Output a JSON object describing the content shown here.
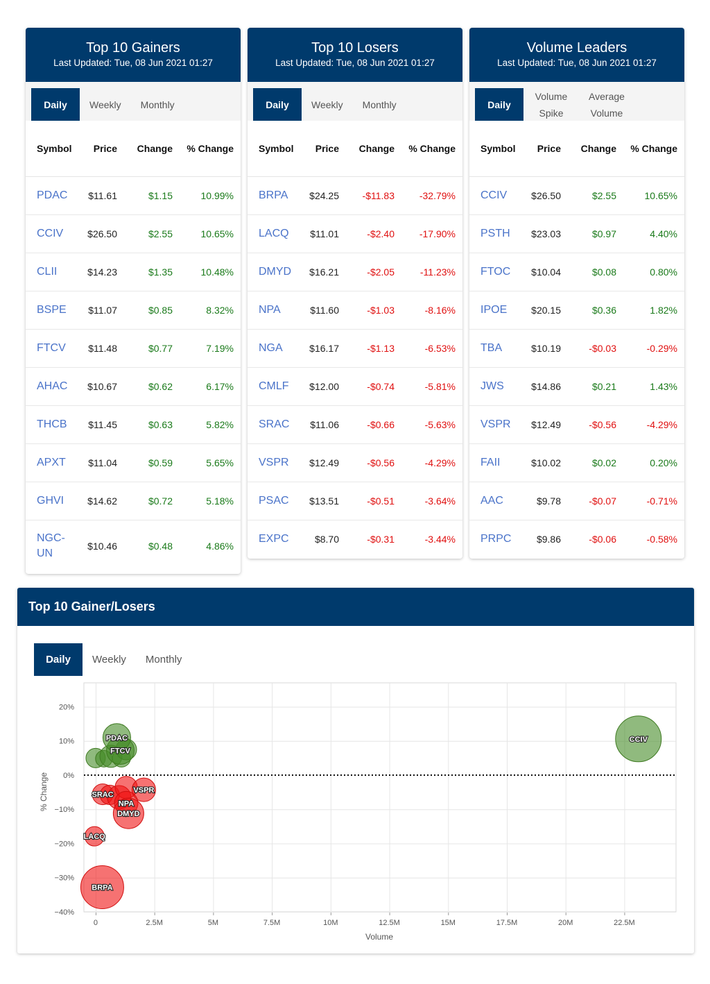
{
  "gainers": {
    "title": "Top 10 Gainers",
    "updated": "Last Updated: Tue, 08 Jun 2021 01:27",
    "tabs": [
      "Daily",
      "Weekly",
      "Monthly"
    ],
    "headers": [
      "Symbol",
      "Price",
      "Change",
      "% Change"
    ],
    "rows": [
      {
        "symbol": "PDAC",
        "price": "$11.61",
        "change": "$1.15",
        "pct": "10.99%",
        "dir": "pos"
      },
      {
        "symbol": "CCIV",
        "price": "$26.50",
        "change": "$2.55",
        "pct": "10.65%",
        "dir": "pos"
      },
      {
        "symbol": "CLII",
        "price": "$14.23",
        "change": "$1.35",
        "pct": "10.48%",
        "dir": "pos"
      },
      {
        "symbol": "BSPE",
        "price": "$11.07",
        "change": "$0.85",
        "pct": "8.32%",
        "dir": "pos"
      },
      {
        "symbol": "FTCV",
        "price": "$11.48",
        "change": "$0.77",
        "pct": "7.19%",
        "dir": "pos"
      },
      {
        "symbol": "AHAC",
        "price": "$10.67",
        "change": "$0.62",
        "pct": "6.17%",
        "dir": "pos"
      },
      {
        "symbol": "THCB",
        "price": "$11.45",
        "change": "$0.63",
        "pct": "5.82%",
        "dir": "pos"
      },
      {
        "symbol": "APXT",
        "price": "$11.04",
        "change": "$0.59",
        "pct": "5.65%",
        "dir": "pos"
      },
      {
        "symbol": "GHVI",
        "price": "$14.62",
        "change": "$0.72",
        "pct": "5.18%",
        "dir": "pos"
      },
      {
        "symbol": "NGC-UN",
        "price": "$10.46",
        "change": "$0.48",
        "pct": "4.86%",
        "dir": "pos"
      }
    ]
  },
  "losers": {
    "title": "Top 10 Losers",
    "updated": "Last Updated: Tue, 08 Jun 2021 01:27",
    "tabs": [
      "Daily",
      "Weekly",
      "Monthly"
    ],
    "headers": [
      "Symbol",
      "Price",
      "Change",
      "% Change"
    ],
    "rows": [
      {
        "symbol": "BRPA",
        "price": "$24.25",
        "change": "-$11.83",
        "pct": "-32.79%",
        "dir": "neg"
      },
      {
        "symbol": "LACQ",
        "price": "$11.01",
        "change": "-$2.40",
        "pct": "-17.90%",
        "dir": "neg"
      },
      {
        "symbol": "DMYD",
        "price": "$16.21",
        "change": "-$2.05",
        "pct": "-11.23%",
        "dir": "neg"
      },
      {
        "symbol": "NPA",
        "price": "$11.60",
        "change": "-$1.03",
        "pct": "-8.16%",
        "dir": "neg"
      },
      {
        "symbol": "NGA",
        "price": "$16.17",
        "change": "-$1.13",
        "pct": "-6.53%",
        "dir": "neg"
      },
      {
        "symbol": "CMLF",
        "price": "$12.00",
        "change": "-$0.74",
        "pct": "-5.81%",
        "dir": "neg"
      },
      {
        "symbol": "SRAC",
        "price": "$11.06",
        "change": "-$0.66",
        "pct": "-5.63%",
        "dir": "neg"
      },
      {
        "symbol": "VSPR",
        "price": "$12.49",
        "change": "-$0.56",
        "pct": "-4.29%",
        "dir": "neg"
      },
      {
        "symbol": "PSAC",
        "price": "$13.51",
        "change": "-$0.51",
        "pct": "-3.64%",
        "dir": "neg"
      },
      {
        "symbol": "EXPC",
        "price": "$8.70",
        "change": "-$0.31",
        "pct": "-3.44%",
        "dir": "neg"
      }
    ]
  },
  "volume": {
    "title": "Volume Leaders",
    "updated": "Last Updated: Tue, 08 Jun 2021 01:27",
    "tabs": [
      "Daily",
      "Volume Spike",
      "Average Volume"
    ],
    "headers": [
      "Symbol",
      "Price",
      "Change",
      "% Change"
    ],
    "rows": [
      {
        "symbol": "CCIV",
        "price": "$26.50",
        "change": "$2.55",
        "pct": "10.65%",
        "dir": "pos"
      },
      {
        "symbol": "PSTH",
        "price": "$23.03",
        "change": "$0.97",
        "pct": "4.40%",
        "dir": "pos"
      },
      {
        "symbol": "FTOC",
        "price": "$10.04",
        "change": "$0.08",
        "pct": "0.80%",
        "dir": "pos"
      },
      {
        "symbol": "IPOE",
        "price": "$20.15",
        "change": "$0.36",
        "pct": "1.82%",
        "dir": "pos"
      },
      {
        "symbol": "TBA",
        "price": "$10.19",
        "change": "-$0.03",
        "pct": "-0.29%",
        "dir": "neg"
      },
      {
        "symbol": "JWS",
        "price": "$14.86",
        "change": "$0.21",
        "pct": "1.43%",
        "dir": "pos"
      },
      {
        "symbol": "VSPR",
        "price": "$12.49",
        "change": "-$0.56",
        "pct": "-4.29%",
        "dir": "neg"
      },
      {
        "symbol": "FAII",
        "price": "$10.02",
        "change": "$0.02",
        "pct": "0.20%",
        "dir": "pos"
      },
      {
        "symbol": "AAC",
        "price": "$9.78",
        "change": "-$0.07",
        "pct": "-0.71%",
        "dir": "neg"
      },
      {
        "symbol": "PRPC",
        "price": "$9.86",
        "change": "-$0.06",
        "pct": "-0.58%",
        "dir": "neg"
      }
    ]
  },
  "bubble": {
    "title": "Top 10 Gainer/Losers",
    "tabs": [
      "Daily",
      "Weekly",
      "Monthly"
    ]
  },
  "colors": {
    "header": "#003a6c",
    "link": "#4a73c9",
    "positive": "#1a7a1a",
    "negative": "#e01010"
  },
  "chart_data": {
    "type": "scatter",
    "xlabel": "Volume",
    "ylabel": "% Change",
    "xlim": [
      -500000,
      24700000
    ],
    "ylim": [
      -40,
      27
    ],
    "xticks": [
      0,
      2500000,
      5000000,
      7500000,
      10000000,
      12500000,
      15000000,
      17500000,
      20000000,
      22500000
    ],
    "xtick_labels": [
      "0",
      "2.5M",
      "5M",
      "7.5M",
      "10M",
      "12.5M",
      "15M",
      "17.5M",
      "20M",
      "22.5M"
    ],
    "yticks": [
      20,
      10,
      0,
      -10,
      -20,
      -30,
      -40
    ],
    "ytick_labels": [
      "20%",
      "10%",
      "0%",
      "−10%",
      "−20%",
      "−30%",
      "−40%"
    ],
    "zero_line": "dotted",
    "grid": true,
    "points": [
      {
        "label": "",
        "x": 0,
        "y": 5.0,
        "size": 14,
        "dir": "pos"
      },
      {
        "label": "",
        "x": 350000,
        "y": 4.8,
        "size": 12,
        "dir": "pos"
      },
      {
        "label": "",
        "x": 650000,
        "y": 5.5,
        "size": 16,
        "dir": "pos"
      },
      {
        "label": "",
        "x": 1100000,
        "y": 5.0,
        "size": 13,
        "dir": "pos"
      },
      {
        "label": "",
        "x": 1300000,
        "y": 7.5,
        "size": 15,
        "dir": "pos"
      },
      {
        "label": "FTCV",
        "x": 1050000,
        "y": 7.2,
        "size": 20,
        "dir": "pos"
      },
      {
        "label": "PDAC",
        "x": 900000,
        "y": 11.0,
        "size": 20,
        "dir": "pos"
      },
      {
        "label": "CCIV",
        "x": 23100000,
        "y": 10.6,
        "size": 33,
        "dir": "pos"
      },
      {
        "label": "SRAC",
        "x": 300000,
        "y": -5.6,
        "size": 15,
        "dir": "neg"
      },
      {
        "label": "",
        "x": 600000,
        "y": -5.8,
        "size": 14,
        "dir": "neg"
      },
      {
        "label": "",
        "x": 1000000,
        "y": -6.5,
        "size": 17,
        "dir": "neg"
      },
      {
        "label": "",
        "x": 1300000,
        "y": -3.6,
        "size": 16,
        "dir": "neg"
      },
      {
        "label": "VSPR",
        "x": 2050000,
        "y": -4.3,
        "size": 17,
        "dir": "neg"
      },
      {
        "label": "NPA",
        "x": 1300000,
        "y": -8.2,
        "size": 17,
        "dir": "neg"
      },
      {
        "label": "DMYD",
        "x": 1400000,
        "y": -11.2,
        "size": 22,
        "dir": "neg"
      },
      {
        "label": "LACQ",
        "x": -50000,
        "y": -17.9,
        "size": 14,
        "dir": "neg"
      },
      {
        "label": "BRPA",
        "x": 280000,
        "y": -32.8,
        "size": 31,
        "dir": "neg"
      }
    ]
  }
}
